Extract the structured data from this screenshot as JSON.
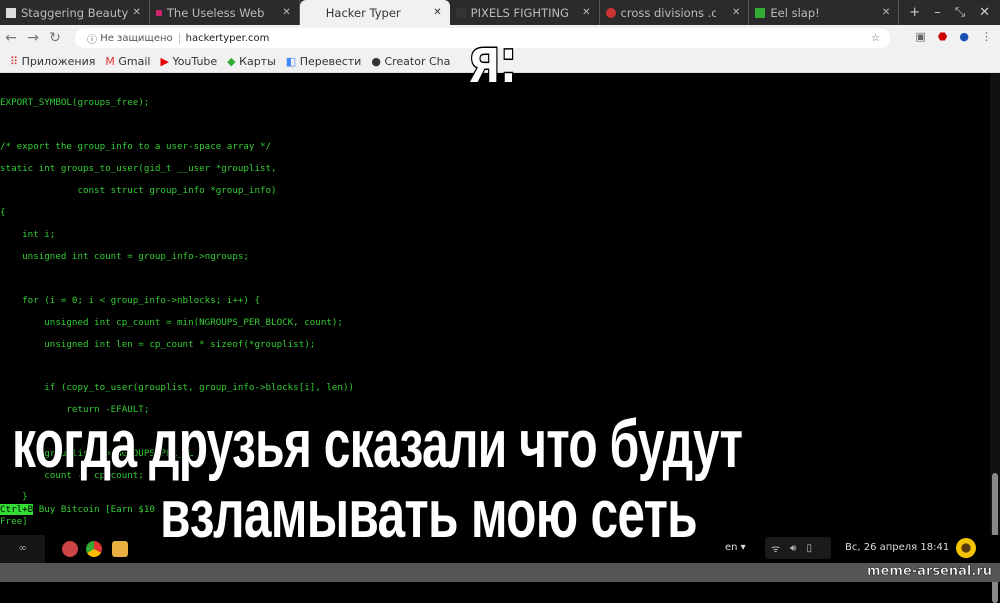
{
  "tabs": [
    {
      "label": "Staggering Beauty"
    },
    {
      "label": "The Useless Web"
    },
    {
      "label": "Hacker Typer",
      "active": true
    },
    {
      "label": "PIXELS FIGHTING"
    },
    {
      "label": "cross divisions .com"
    },
    {
      "label": "Eel slap!"
    }
  ],
  "address": {
    "security": "Не защищено",
    "url": "hackertyper.com"
  },
  "bookmarks": [
    "Приложения",
    "Gmail",
    "YouTube",
    "Карты",
    "Перевести",
    "Creator Cha"
  ],
  "code_lines": [
    "EXPORT_SYMBOL(groups_free);",
    "/* export the group_info to a user-space array */",
    "static int groups_to_user(gid_t __user *grouplist,",
    "              const struct group_info *group_info)",
    "{",
    "    int i;",
    "    unsigned int count = group_info->ngroups;",
    "    for (i = 0; i < group_info->nblocks; i++) {",
    "        unsigned int cp_count = min(NGROUPS_PER_BLOCK, count);",
    "        unsigned int len = cp_count * sizeof(*grouplist);",
    "        if (copy_to_user(grouplist, group_info->blocks[i], len))",
    "            return -EFAULT;",
    "        grouplist += NGROUPS_PER_BL",
    "        count -= cp_count;",
    "    }"
  ],
  "promo": {
    "key": "Ctrl+B",
    "text": " Buy Bitcoin [Earn $10",
    "text2": "Free]"
  },
  "taskbar": {
    "lang": "en",
    "datetime": "Вс, 26 апреля  18:41"
  },
  "meme": {
    "top": "я:",
    "bottom1": "когда друзья сказали что будут",
    "bottom2": "взламывать мою сеть"
  },
  "watermark": "meme-arsenal.ru"
}
